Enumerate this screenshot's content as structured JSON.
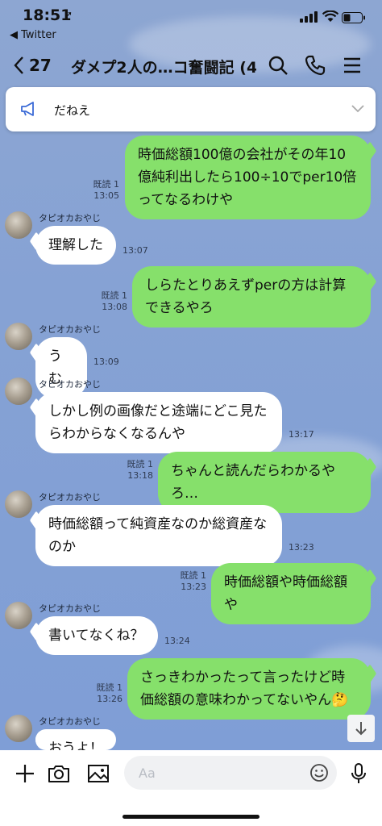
{
  "status": {
    "time": "18:51",
    "back_app": "◀ Twitter"
  },
  "nav": {
    "back_count": "27",
    "title": "ダメプ2人の…コ奮闘記 (4)"
  },
  "announcement": {
    "text": "だねえ"
  },
  "messages": [
    {
      "type": "sent",
      "text": "時価総額100億の会社がその年10億純利出したら100÷10でper10倍ってなるわけや",
      "read": "既読 1",
      "time": "13:05"
    },
    {
      "type": "recv",
      "sender": "タピオカおやじ",
      "text": "理解した",
      "time": "13:07"
    },
    {
      "type": "sent",
      "text": "しらたとりあえずperの方は計算できるやろ",
      "read": "既読 1",
      "time": "13:08"
    },
    {
      "type": "recv",
      "sender": "タピオカおやじ",
      "text": "うむ",
      "time": "13:09"
    },
    {
      "type": "recv",
      "sender": "タピオカおやじ",
      "text": "しかし例の画像だと途端にどこ見たらわからなくなるんや",
      "time": "13:17"
    },
    {
      "type": "sent",
      "text": "ちゃんと読んだらわかるやろ…",
      "read": "既読 1",
      "time": "13:18"
    },
    {
      "type": "recv",
      "sender": "タピオカおやじ",
      "text": "時価総額って純資産なのか総資産なのか",
      "time": "13:23"
    },
    {
      "type": "sent",
      "text": "時価総額や時価総額や",
      "read": "既読 1",
      "time": "13:23"
    },
    {
      "type": "recv",
      "sender": "タピオカおやじ",
      "text": "書いてなくね？",
      "time": "13:24"
    },
    {
      "type": "sent",
      "text": "さっきわかったって言ったけど時価総額の意味わかってないやん🤔",
      "read": "既読 1",
      "time": "13:26"
    },
    {
      "type": "recv",
      "sender": "タピオカおやじ",
      "text": "おうよ！",
      "time": ""
    }
  ],
  "input": {
    "placeholder": "Aa"
  },
  "colors": {
    "sent_bubble": "#86e06b",
    "recv_bubble": "#ffffff",
    "background": "#8aa6d6"
  }
}
